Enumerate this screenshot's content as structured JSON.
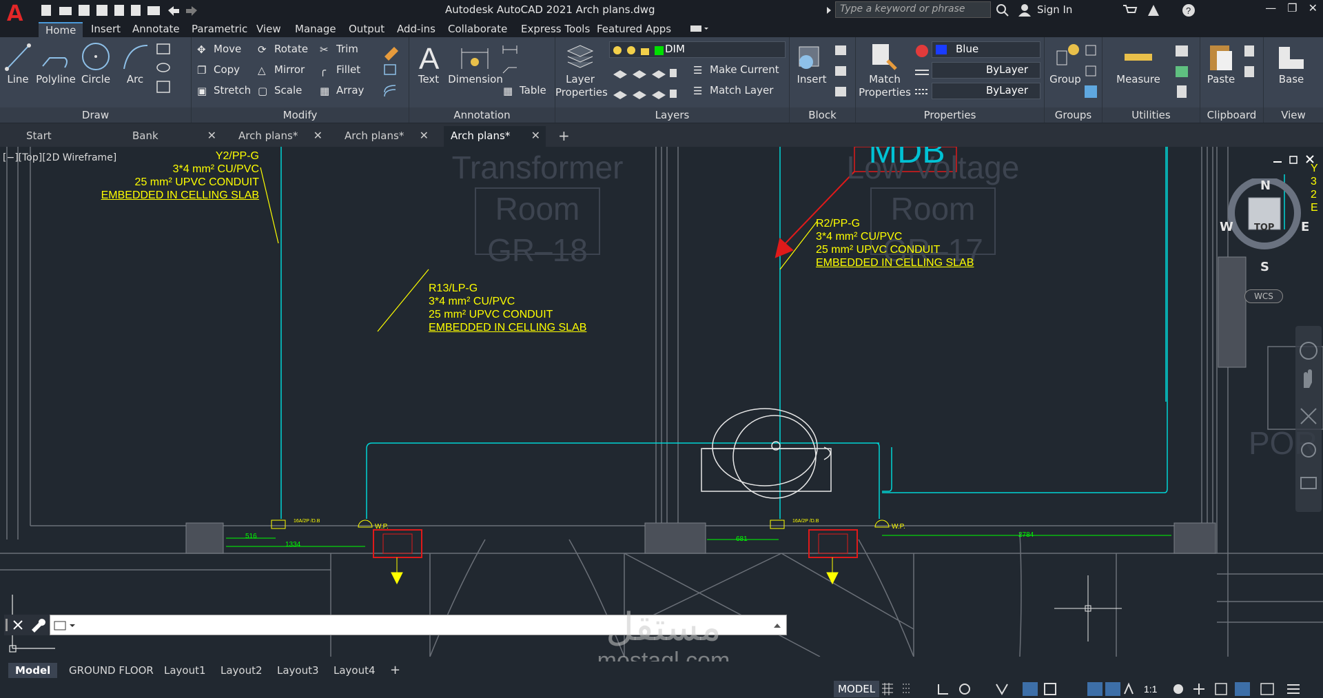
{
  "window": {
    "title": "Autodesk AutoCAD 2021   Arch plans.dwg",
    "search_placeholder": "Type a keyword or phrase",
    "sign_in": "Sign In"
  },
  "menu": {
    "tabs": [
      "Home",
      "Insert",
      "Annotate",
      "Parametric",
      "View",
      "Manage",
      "Output",
      "Add-ins",
      "Collaborate",
      "Express Tools",
      "Featured Apps"
    ]
  },
  "ribbon": {
    "draw": {
      "title": "Draw",
      "line": "Line",
      "polyline": "Polyline",
      "circle": "Circle",
      "arc": "Arc"
    },
    "modify": {
      "title": "Modify",
      "move": "Move",
      "rotate": "Rotate",
      "trim": "Trim",
      "copy": "Copy",
      "mirror": "Mirror",
      "fillet": "Fillet",
      "stretch": "Stretch",
      "scale": "Scale",
      "array": "Array"
    },
    "annotation": {
      "title": "Annotation",
      "text": "Text",
      "dimension": "Dimension",
      "table": "Table"
    },
    "layers": {
      "title": "Layers",
      "layer_properties": "Layer Properties",
      "current_layer": "DIM",
      "make_current": "Make Current",
      "match_layer": "Match Layer"
    },
    "block": {
      "title": "Block",
      "insert": "Insert"
    },
    "properties": {
      "title": "Properties",
      "match_properties": "Match Properties",
      "color": "Blue",
      "linetype": "ByLayer",
      "lineweight": "ByLayer"
    },
    "groups": {
      "title": "Groups",
      "group": "Group"
    },
    "utilities": {
      "title": "Utilities",
      "measure": "Measure"
    },
    "clipboard": {
      "title": "Clipboard",
      "paste": "Paste"
    },
    "view": {
      "title": "View",
      "base": "Base"
    }
  },
  "doc_tabs": [
    {
      "label": "Start"
    },
    {
      "label": "Bank"
    },
    {
      "label": "Arch plans*"
    },
    {
      "label": "Arch plans*"
    },
    {
      "label": "Arch plans*"
    }
  ],
  "viewport": {
    "label": "[−][Top][2D Wireframe]"
  },
  "drawing": {
    "rooms": [
      {
        "line1": "Transformer",
        "line2": "Room",
        "code": "GR–18"
      },
      {
        "line1": "Low Voltage",
        "line2": "Room",
        "code": "GR–17"
      },
      {
        "line1": "MDB"
      }
    ],
    "annotations": [
      {
        "l1": "Y2/PP-G",
        "l2": "3*4 mm² CU/PVC",
        "l3": "25 mm² UPVC CONDUIT",
        "l4": "EMBEDDED IN CELLING SLAB"
      },
      {
        "l1": "R13/LP-G",
        "l2": "3*4 mm² CU/PVC",
        "l3": "25 mm² UPVC CONDUIT",
        "l4": "EMBEDDED IN CELLING SLAB"
      },
      {
        "l1": "R2/PP-G",
        "l2": "3*4 mm² CU/PVC",
        "l3": "25 mm² UPVC CONDUIT",
        "l4": "EMBEDDED IN CELLING SLAB"
      }
    ],
    "dims": {
      "d1": "516",
      "d2": "1334",
      "d3": "681",
      "d4": "2784"
    },
    "small_labels": {
      "wp": "W.P.",
      "sw": "16A/2P /D.B"
    },
    "side_text": "POR"
  },
  "viewcube": {
    "n": "N",
    "s": "S",
    "e": "E",
    "w": "W",
    "top": "TOP",
    "wcs": "WCS"
  },
  "layout_tabs": [
    "Model",
    "GROUND FLOOR",
    "Layout1",
    "Layout2",
    "Layout3",
    "Layout4"
  ],
  "status": {
    "model": "MODEL",
    "scale": "1:1"
  },
  "watermark": {
    "arabic": "مستقل",
    "latin": "mostaql.com"
  },
  "colors": {
    "ribbon": "#3b4452",
    "canvas": "#212830",
    "annotation": "#ffff00",
    "wire": "#00d6d6",
    "device": "#e01a1a",
    "dim": "#00ff00"
  }
}
